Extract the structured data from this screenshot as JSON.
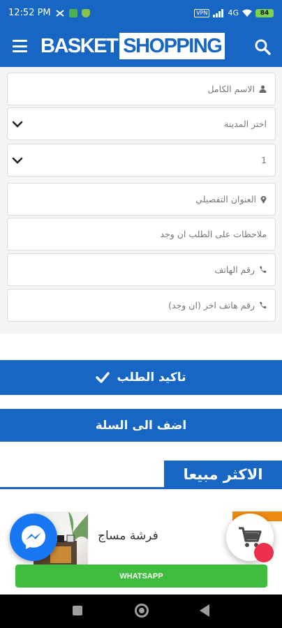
{
  "status_bar": {
    "time": "12:52 PM",
    "vpn": "VPN",
    "net": "4G",
    "battery": "84"
  },
  "header": {
    "logo_part1": "BASKET",
    "logo_part2": "SHOPPING",
    "menu_icon": "hamburger-icon",
    "search_icon": "search-icon"
  },
  "form": {
    "full_name_placeholder": "الاسم الكامل",
    "city_select": "اختر المدينة",
    "quantity_select": "1",
    "address_placeholder": "العنوان التفصيلي",
    "notes_placeholder": "ملاحظات على الطلب ان وجد",
    "phone_placeholder": "رقم الهاتف",
    "alt_phone_placeholder": "رقم هاتف اخر (ان وجد)"
  },
  "actions": {
    "confirm_label": "تاكيد الطلب",
    "add_to_cart_label": "اضف الى السلة"
  },
  "best_sellers": {
    "title": "الاكثر مبيعا",
    "product_name": "فرشة مساج"
  },
  "whatsapp_label": "WHATSAPP",
  "colors": {
    "primary": "#1766c4",
    "whatsapp": "#3fbd3f",
    "messenger": "#1877f2",
    "badge": "#ec2f4b",
    "tag": "#ef8b12"
  }
}
